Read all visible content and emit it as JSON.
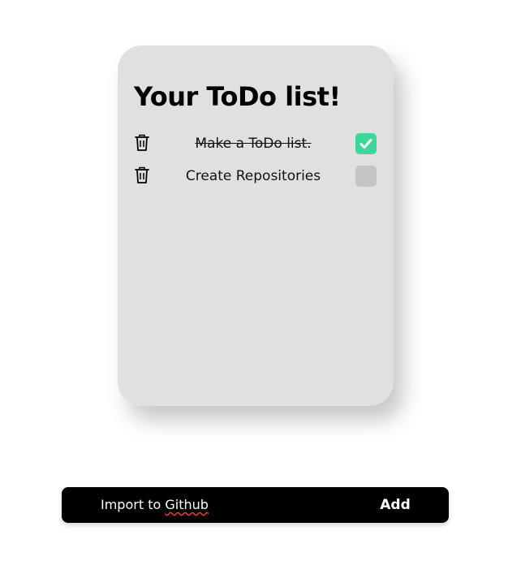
{
  "card": {
    "title": "Your ToDo list!"
  },
  "todos": [
    {
      "text": "Make a ToDo list.",
      "done": true,
      "icon": "trash-icon"
    },
    {
      "text": "Create Repositories",
      "done": false,
      "icon": "trash-icon"
    }
  ],
  "input_bar": {
    "value_prefix": "Import to ",
    "value_misspelled_word": "Github",
    "add_label": "Add"
  },
  "colors": {
    "card_bg": "#e0e0e0",
    "checked": "#3fd69a",
    "unchecked": "#c4c4c4",
    "bar_bg": "#000000"
  }
}
